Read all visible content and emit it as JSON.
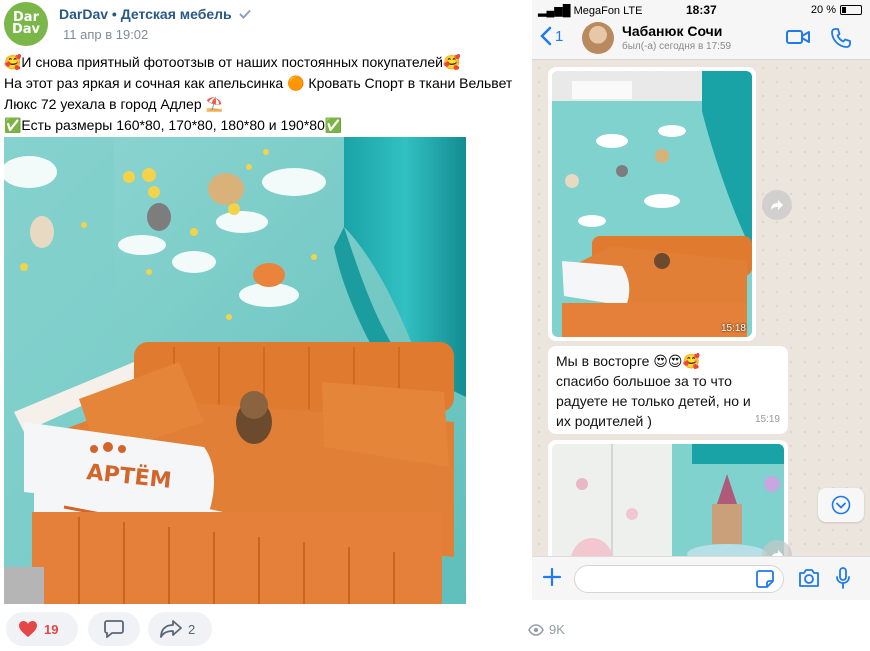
{
  "post": {
    "author_avatar_line1": "Dar",
    "author_avatar_line2": "Dav",
    "author_name": "DarDav",
    "separator": "•",
    "group_name": "Детская мебель",
    "date": "11 апр в 19:02",
    "text_lines": [
      "🥰И снова приятный фотоотзыв от наших постоянных покупателей🥰",
      "На этот раз яркая и сочная как апельсинка 🟠 Кровать Спорт в ткани Вельвет",
      "Люкс 72 уехала в город Адлер ⛱️",
      "✅Есть размеры 160*80, 170*80, 180*80 и 190*80✅"
    ],
    "photo_bed_label": "АРТЁМ",
    "likes": "19",
    "shares": "2",
    "views": "9K"
  },
  "phone": {
    "carrier": "MegaFon",
    "network": "LTE",
    "time": "18:37",
    "battery": "20 %",
    "back_count": "1",
    "contact_name": "Чабанюк Сочи",
    "contact_status": "был(-а) сегодня в 17:59",
    "photo_time": "15:18",
    "message_text": "Мы в восторге 😍😍🥰\nспасибо большое за то что\nрадуете не только детей, но и\nих родителей )",
    "message_time": "15:19",
    "input_placeholder": ""
  },
  "colors": {
    "vk_link": "#2a5885",
    "like_red": "#e64646",
    "wa_blue": "#1f7aec",
    "wall_teal": "#6fc8c6",
    "orange": "#e0782c"
  },
  "icons": {
    "like": "heart-icon",
    "comment": "comment-icon",
    "share": "share-icon",
    "views": "eye-icon",
    "video": "video-camera-icon",
    "call": "phone-icon"
  }
}
